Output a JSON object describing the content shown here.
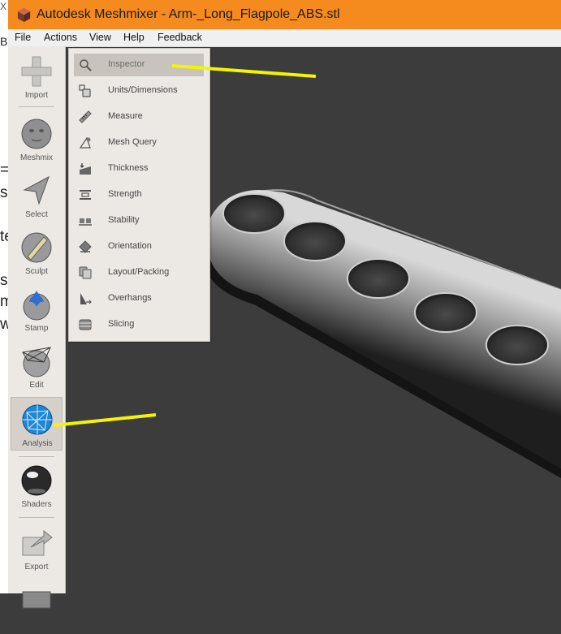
{
  "window": {
    "title": "Autodesk Meshmixer - Arm-_Long_Flagpole_ABS.stl"
  },
  "background_window": {
    "fragments": [
      "X",
      "B",
      "=",
      "so",
      "te",
      "s",
      "m",
      "w"
    ]
  },
  "menu": {
    "items": [
      "File",
      "Actions",
      "View",
      "Help",
      "Feedback"
    ]
  },
  "tools": [
    {
      "label": "Import",
      "icon": "import-icon"
    },
    {
      "label": "Meshmix",
      "icon": "meshmix-icon"
    },
    {
      "label": "Select",
      "icon": "select-icon"
    },
    {
      "label": "Sculpt",
      "icon": "sculpt-icon"
    },
    {
      "label": "Stamp",
      "icon": "stamp-icon"
    },
    {
      "label": "Edit",
      "icon": "edit-icon"
    },
    {
      "label": "Analysis",
      "icon": "analysis-icon",
      "active": true
    },
    {
      "label": "Shaders",
      "icon": "shaders-icon"
    },
    {
      "label": "Export",
      "icon": "export-icon"
    }
  ],
  "analysis_menu": {
    "items": [
      {
        "label": "Inspector",
        "icon": "magnifier-icon",
        "selected": true
      },
      {
        "label": "Units/Dimensions",
        "icon": "units-icon"
      },
      {
        "label": "Measure",
        "icon": "ruler-icon"
      },
      {
        "label": "Mesh Query",
        "icon": "mesh-query-icon"
      },
      {
        "label": "Thickness",
        "icon": "thickness-icon"
      },
      {
        "label": "Strength",
        "icon": "strength-icon"
      },
      {
        "label": "Stability",
        "icon": "stability-icon"
      },
      {
        "label": "Orientation",
        "icon": "orientation-icon"
      },
      {
        "label": "Layout/Packing",
        "icon": "layout-packing-icon"
      },
      {
        "label": "Overhangs",
        "icon": "overhangs-icon"
      },
      {
        "label": "Slicing",
        "icon": "slicing-icon"
      }
    ]
  },
  "colors": {
    "titlebar": "#f58a1f",
    "viewport_background": "#3c3c3c",
    "annotation": "#f5f500",
    "panel": "#ece9e4"
  }
}
